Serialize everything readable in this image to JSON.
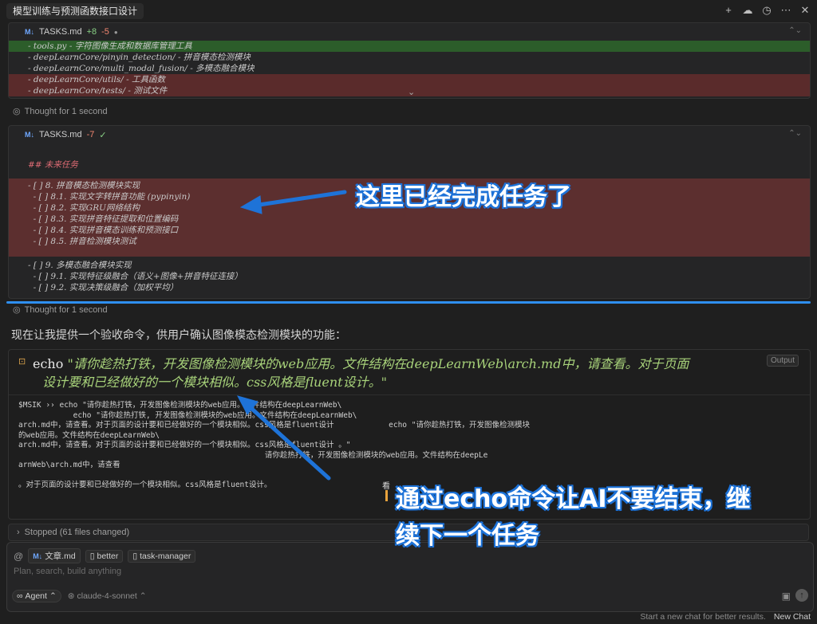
{
  "window": {
    "title": "模型训练与预测函数接口设计"
  },
  "diff1": {
    "filename": "TASKS.md",
    "added": "+8",
    "removed": "-5",
    "dot": "●",
    "lines": [
      {
        "text": "- tools.py - 字符图像生成和数据库管理工具",
        "kind": "add"
      },
      {
        "text": "- deepLearnCore/pinyin_detection/ - 拼音模态检测模块",
        "kind": "normal"
      },
      {
        "text": "- deepLearnCore/multi_modal_fusion/ - 多模态融合模块",
        "kind": "normal"
      },
      {
        "text": "- deepLearnCore/utils/ - 工具函数",
        "kind": "del"
      },
      {
        "text": "- deepLearnCore/tests/ - 测试文件",
        "kind": "del"
      }
    ]
  },
  "thought1": {
    "label": "Thought for 1 second"
  },
  "diff2": {
    "filename": "TASKS.md",
    "removed": "-7",
    "check": "✓",
    "heading": "## 未来任务",
    "deleted": [
      "- [ ] 8. 拼音模态检测模块实现",
      "  - [ ] 8.1. 实现文字转拼音功能 (pypinyin)",
      "  - [ ] 8.2. 实现GRU网络结构",
      "  - [ ] 8.3. 实现拼音特征提取和位置编码",
      "  - [ ] 8.4. 实现拼音模态训练和预测接口",
      "  - [ ] 8.5. 拼音检测模块测试"
    ],
    "normal": [
      "- [ ] 9. 多模态融合模块实现",
      "  - [ ] 9.1. 实现特征级融合（语义+图像+拼音特征连接）",
      "  - [ ] 9.2. 实现决策级融合（加权平均）"
    ]
  },
  "thought2": {
    "label": "Thought for 1 second"
  },
  "message": "现在让我提供一个验收命令，供用户确认图像模态检测模块的功能：",
  "terminal": {
    "cmd": "echo",
    "arg_line1": "\"请你趁热打铁，开发图像检测模块的web应用。文件结构在deepLearnWeb\\arch.md中，请查看。对于页面",
    "arg_line2": "设计要和已经做好的一个模块相似。css风格是fluent设计。\"",
    "output_badge": "Output",
    "out": [
      "$MSIK ›› echo \"请你趁热打铁，开发图像检测模块的web应用。文件结构在deepLearnWeb\\",
      "            echo \"请你趁热打铁, 开发图像检测模块的web应用。文件结构在deepLearnWeb\\",
      "arch.md中，请查看。对于页面的设计要和已经做好的一个模块相似。css风格是fluent设计            echo \"请你趁热打铁，开发图像检测模块",
      "的web应用。文件结构在deepLearnWeb\\",
      "arch.md中，请查看。对于页面的设计要和已经做好的一个模块相似。css风格是fluent设计 。\"",
      "                                                      请你趁热打铁，开发图像检测模块的web应用。文件结构在deepLe",
      "arnWeb\\arch.md中，请查看",
      "",
      "。对于页面的设计要和已经做好的一个模块相似。css风格是fluent设计。"
    ],
    "stray_char": "看"
  },
  "annotations": {
    "callout1": "这里已经完成任务了",
    "callout2_line1": "通过echo命令让AI不要结束，继",
    "callout2_line2": "续下一个任务",
    "color": "#1e73d8"
  },
  "status": {
    "stopped": "Stopped (61 files changed)"
  },
  "composer": {
    "chips": [
      {
        "icon": "M↓",
        "label": "文章.md"
      },
      {
        "icon": "▯",
        "label": "better"
      },
      {
        "icon": "▯",
        "label": "task-manager"
      }
    ],
    "placeholder": "Plan, search, build anything",
    "mode": "Agent",
    "model": "claude-4-sonnet"
  },
  "footer": {
    "hint": "Start a new chat for better results.",
    "new_chat": "New Chat"
  }
}
